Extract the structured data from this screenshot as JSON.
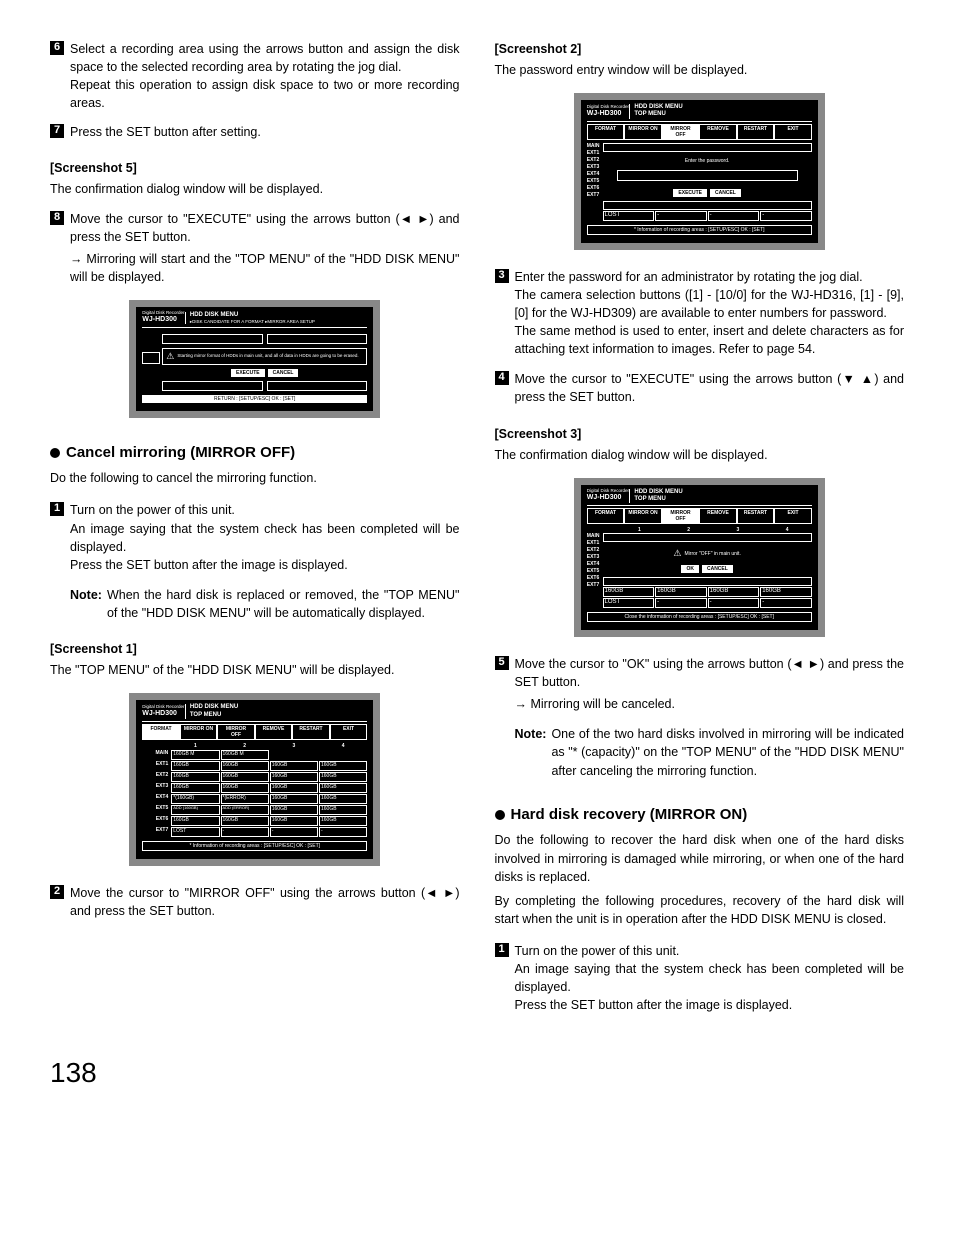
{
  "page_number": "138",
  "left": {
    "step6": "Select a recording area using the arrows button and assign the disk space to the selected recording area by rotating the jog dial.",
    "step6b": "Repeat this operation to assign disk space to two or more recording areas.",
    "step7": "Press the SET button after setting.",
    "sh5_label": "[Screenshot 5]",
    "sh5_desc": "The confirmation dialog window will be displayed.",
    "step8a": "Move the cursor to \"EXECUTE\" using the arrows button (",
    "step8b": ") and press the SET button.",
    "step8_arrow": "→ Mirroring will start and the \"TOP MENU\" of the \"HDD DISK MENU\" will be displayed.",
    "shot1": {
      "recorder": "Digital Disk Recorder",
      "model": "WJ-HD300",
      "menu1": "HDD DISK MENU",
      "menu2": "▸DISK CANDIDATE FOR A FORMAT ▸MIRROR AREA SETUP",
      "warn": "Starting mirror format of HDDs in main unit, and all of data in HDDs are going to be erased.",
      "btn_exec": "EXECUTE",
      "btn_cancel": "CANCEL",
      "footer": "RETURN : [SETUP/ESC] OK : [SET]"
    },
    "cancel_heading": "Cancel mirroring (MIRROR OFF)",
    "cancel_intro": "Do the following to cancel the mirroring function.",
    "c_step1a": "Turn on the power of this unit.",
    "c_step1b": "An image saying that the system check has been completed will be displayed.",
    "c_step1c": "Press the SET button after the image is displayed.",
    "c_note_lbl": "Note:",
    "c_note": "When the hard disk is replaced or removed, the \"TOP MENU\" of the \"HDD DISK MENU\" will be automatically displayed.",
    "sh1_label": "[Screenshot 1]",
    "sh1_desc": "The \"TOP MENU\" of the \"HDD DISK MENU\" will be displayed.",
    "shot2": {
      "menu2": "TOP MENU",
      "tabs": [
        "FORMAT",
        "MIRROR ON",
        "MIRROR OFF",
        "REMOVE",
        "RESTART",
        "EXIT"
      ],
      "cols": [
        "1",
        "2",
        "3",
        "4"
      ],
      "rows": [
        "MAIN",
        "EXT1",
        "EXT2",
        "EXT3",
        "EXT4",
        "EXT5",
        "EXT6",
        "EXT7"
      ],
      "footer": "* Information of recording areas : [SETUP/ESC] OK : [SET]"
    },
    "c_step2a": "Move the cursor to \"MIRROR OFF\" using the arrows button (",
    "c_step2b": ") and press the SET button."
  },
  "right": {
    "sh2_label": "[Screenshot 2]",
    "sh2_desc": "The password entry window will be displayed.",
    "shot3": {
      "menu2": "TOP MENU",
      "prompt": "Enter the password.",
      "btn_exec": "EXECUTE",
      "btn_cancel": "CANCEL",
      "footer": "* Information of recording areas : [SETUP/ESC] OK : [SET]"
    },
    "step3a": "Enter the password for an administrator by rotating the jog dial.",
    "step3b": "The camera selection buttons ([1] - [10/0] for the WJ-HD316, [1] - [9], [0] for the WJ-HD309) are available to enter numbers for password.",
    "step3c": "The same method is used to enter, insert and delete characters as for attaching text information to images. Refer to page 54.",
    "step4a": "Move the cursor to \"EXECUTE\" using the arrows button (",
    "step4b": ") and press the SET button.",
    "sh3_label": "[Screenshot 3]",
    "sh3_desc": "The confirmation dialog window will be displayed.",
    "shot4": {
      "menu2": "TOP MENU",
      "msg": "Mirror \"OFF\" in main unit.",
      "btn_ok": "OK",
      "btn_cancel": "CANCEL",
      "footer": "Close the information of recording areas : [SETUP/ESC] OK : [SET]"
    },
    "step5a": "Move the cursor to \"OK\" using the arrows button (",
    "step5b": ") and press the SET button.",
    "step5_arrow": "→ Mirroring will be canceled.",
    "step5_note_lbl": "Note:",
    "step5_note": "One of the two hard disks involved in mirroring will be indicated as \"* (capacity)\" on the \"TOP MENU\" of the \"HDD DISK MENU\" after canceling the mirroring function.",
    "recovery_heading": "Hard disk recovery (MIRROR ON)",
    "recovery_p1": "Do the following to recover the hard disk when one of the hard disks involved in mirroring is damaged while mirroring, or when one of the hard disks is replaced.",
    "recovery_p2": "By completing the following procedures, recovery of the hard disk will start when the unit is in operation after the HDD DISK MENU is closed.",
    "r_step1a": "Turn on the power of this unit.",
    "r_step1b": "An image saying that the system check has been completed will be displayed.",
    "r_step1c": "Press the SET button after the image is displayed."
  },
  "shared": {
    "recorder_label": "Digital Disk Recorder",
    "model": "WJ-HD300",
    "hdd_menu": "HDD DISK MENU",
    "rows": [
      "MAIN",
      "EXT1",
      "EXT2",
      "EXT3",
      "EXT4",
      "EXT5",
      "EXT6",
      "EXT7"
    ],
    "lost": "LOST",
    "gb": "160GB"
  }
}
